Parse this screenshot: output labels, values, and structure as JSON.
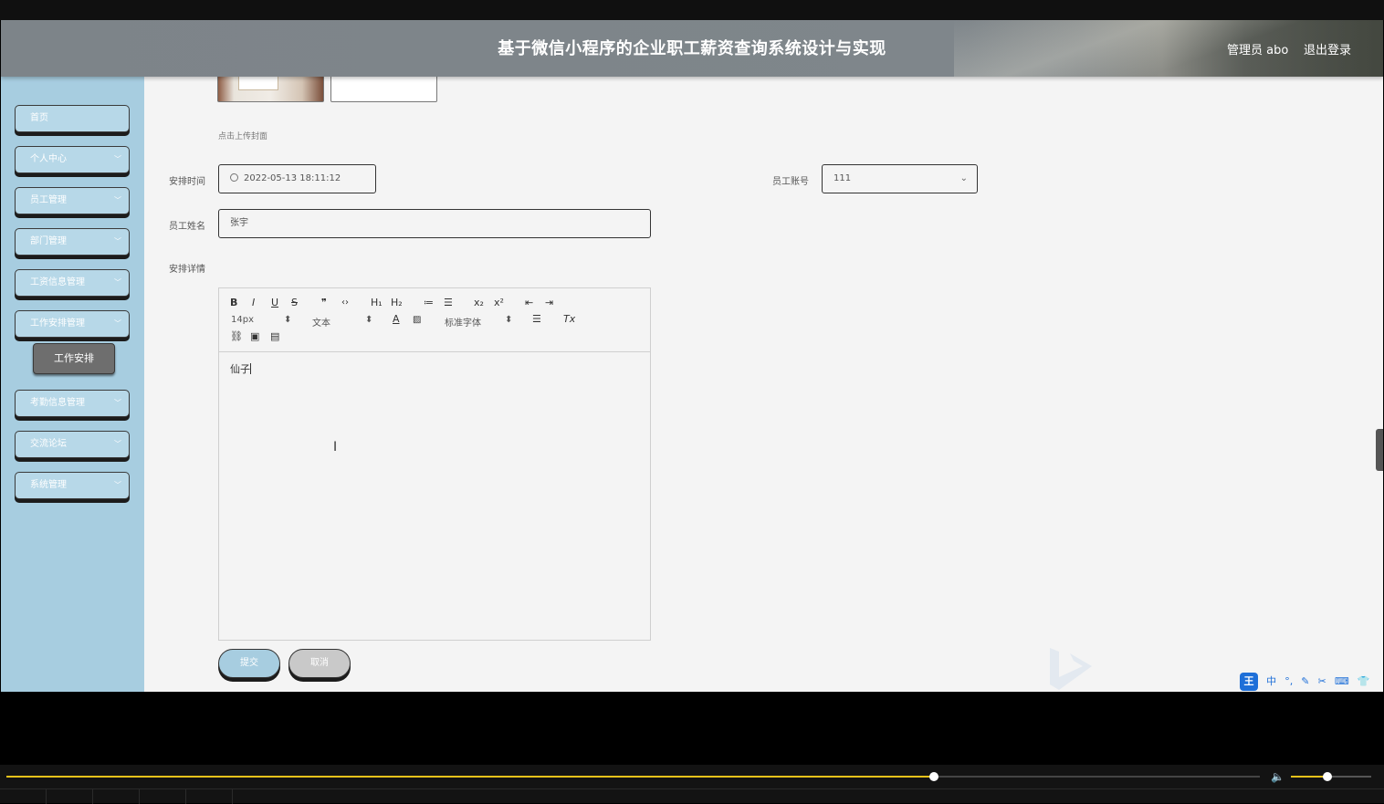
{
  "header": {
    "title": "基于微信小程序的企业职工薪资查询系统设计与实现",
    "user": "管理员 abo",
    "logout": "退出登录"
  },
  "sidebar": {
    "items": [
      {
        "label": "首页",
        "has_submenu": false
      },
      {
        "label": "个人中心",
        "has_submenu": true
      },
      {
        "label": "员工管理",
        "has_submenu": true
      },
      {
        "label": "部门管理",
        "has_submenu": true
      },
      {
        "label": "工资信息管理",
        "has_submenu": true
      },
      {
        "label": "工作安排管理",
        "has_submenu": true
      },
      {
        "label": "考勤信息管理",
        "has_submenu": true
      },
      {
        "label": "交流论坛",
        "has_submenu": true
      },
      {
        "label": "系统管理",
        "has_submenu": true
      }
    ],
    "active_sub": "工作安排"
  },
  "form": {
    "upload_hint": "点击上传封面",
    "schedule_time_label": "安排时间",
    "schedule_time_value": "2022-05-13 18:11:12",
    "employee_account_label": "员工账号",
    "employee_account_value": "111",
    "employee_name_label": "员工姓名",
    "employee_name_value": "张宇",
    "details_label": "安排详情",
    "details_content": "仙子",
    "submit": "提交",
    "cancel": "取消"
  },
  "editor_toolbar": {
    "row1": [
      "B",
      "I",
      "U",
      "S",
      "❞",
      "‹›",
      "H₁",
      "H₂",
      "≔",
      "☰",
      "x₂",
      "x²",
      "⇤",
      "⇥"
    ],
    "font_size": "14px",
    "block_type": "文本",
    "font_family": "标准字体",
    "clear_format": "Tx"
  },
  "player": {
    "progress": 0.74,
    "volume": 0.45
  },
  "colors": {
    "sidebar": "#a7cde0",
    "accent": "#e8c21a",
    "header": "#7d8489"
  }
}
